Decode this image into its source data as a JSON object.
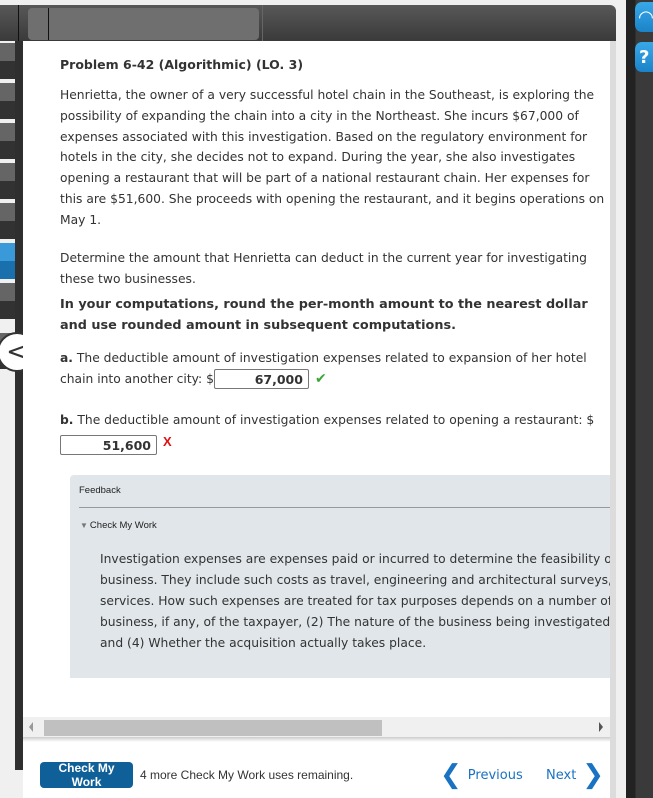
{
  "toolbar": {
    "tabs": [
      "",
      ""
    ]
  },
  "left_nav": {
    "items": [
      {
        "state": "default"
      },
      {
        "state": "default"
      },
      {
        "state": "default"
      },
      {
        "state": "default"
      },
      {
        "state": "default"
      },
      {
        "state": "active"
      },
      {
        "state": "default"
      },
      {
        "state": "default"
      }
    ],
    "collapse_glyph": "<"
  },
  "problem": {
    "title": "Problem 6-42 (Algorithmic) (LO. 3)",
    "paragraph1": "Henrietta, the owner of a very successful hotel chain in the Southeast, is exploring the possibility of expanding the chain into a city in the Northeast. She incurs $67,000 of expenses associated with this investigation. Based on the regulatory environment for hotels in the city, she decides not to expand. During the year, she also investigates opening a restaurant that will be part of a national restaurant chain. Her expenses for this are $51,600. She proceeds with opening the restaurant, and it begins operations on May 1.",
    "paragraph2": "Determine the amount that Henrietta can deduct in the current year for investigating these two businesses.",
    "instruction": "In your computations, round the per-month amount to the nearest dollar and use rounded amount in subsequent computations."
  },
  "questions": {
    "a": {
      "label": "a.",
      "text": "The deductible amount of investigation expenses related to expansion of her hotel chain into another city: $",
      "value": "67,000",
      "status": "correct",
      "status_glyph": "✔"
    },
    "b": {
      "label": "b.",
      "text": "The deductible amount of investigation expenses related to opening a restaurant: $",
      "value": "51,600",
      "status": "incorrect",
      "status_glyph": "X"
    }
  },
  "feedback": {
    "title": "Feedback",
    "toggle_label": "Check My Work",
    "lines": [
      "Investigation expenses are expenses paid or incurred to determine the feasibility of",
      "business. They include such costs as travel, engineering and architectural surveys, m",
      "services. How such expenses are treated for tax purposes depends on a number of v",
      "business, if any, of the taxpayer, (2) The nature of the business being investigated, (",
      "and (4) Whether the acquisition actually takes place."
    ]
  },
  "footer": {
    "check_my_work_label": "Check My Work",
    "remaining_text": "4 more Check My Work uses remaining.",
    "previous_label": "Previous",
    "next_label": "Next"
  },
  "side_tools": {
    "support_glyph": "🎧",
    "help_glyph": "?"
  },
  "colors": {
    "primary_button": "#0f5f99",
    "link": "#1a72c2",
    "correct": "#3aa63a",
    "incorrect": "#e01010",
    "feedback_bg": "#e0e6e9"
  }
}
